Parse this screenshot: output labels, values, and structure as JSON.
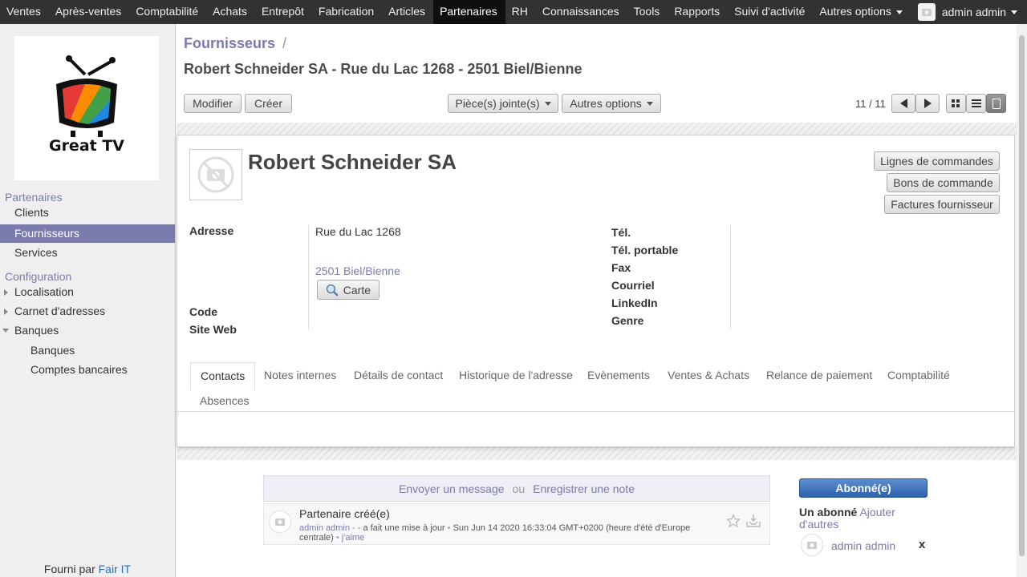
{
  "topbar": {
    "menu": [
      "Ventes",
      "Après-ventes",
      "Comptabilité",
      "Achats",
      "Entrepôt",
      "Fabrication",
      "Articles",
      "Partenaires",
      "RH",
      "Connaissances",
      "Tools",
      "Rapports",
      "Suivi d'activité",
      "Autres options"
    ],
    "active": "Partenaires",
    "user": "admin admin"
  },
  "sidebar": {
    "logo_text": "Great TV",
    "section1": "Partenaires",
    "clients": "Clients",
    "fournisseurs": "Fournisseurs",
    "services": "Services",
    "section2": "Configuration",
    "localisation": "Localisation",
    "carnet": "Carnet d'adresses",
    "banques": "Banques",
    "banques_sub": "Banques",
    "comptes": "Comptes bancaires",
    "powered_prefix": "Fourni par",
    "powered_link": "Fair IT"
  },
  "header": {
    "breadcrumb": "Fournisseurs",
    "breadcrumb_sep": "/",
    "title": "Robert Schneider SA - Rue du Lac 1268 - 2501 Biel/Bienne"
  },
  "toolbar": {
    "edit": "Modifier",
    "create": "Créer",
    "attachments": "Pièce(s) jointe(s)",
    "more": "Autres options",
    "pager": "11 / 11"
  },
  "form": {
    "name": "Robert Schneider SA",
    "buttons": [
      "Lignes de commandes",
      "Bons de commande",
      "Factures fournisseur"
    ],
    "label_address": "Adresse",
    "street": "Rue du Lac 1268",
    "city": "2501 Biel/Bienne",
    "map_button": "Carte",
    "label_code": "Code",
    "label_website": "Site Web",
    "label_phone": "Tél.",
    "label_mobile": "Tél. portable",
    "label_fax": "Fax",
    "label_email": "Courriel",
    "label_linkedin": "LinkedIn",
    "label_gender": "Genre"
  },
  "tabs": [
    "Contacts",
    "Notes internes",
    "Détails de contact",
    "Historique de l'adresse",
    "Evènements",
    "Ventes & Achats",
    "Relance de paiement",
    "Comptabilité",
    "Absences"
  ],
  "chatter": {
    "send_message": "Envoyer un message",
    "or": "ou",
    "log_note": "Enregistrer une note",
    "message_title": "Partenaire créé(e)",
    "author": "admin admin - -",
    "action": "a fait une mise à jour",
    "dot": "•",
    "date": "Sun Jun 14 2020 16:33:04 GMT+0200 (heure d'été d'Europe centrale)",
    "like": "j'aime",
    "followed_button": "Abonné(e)",
    "followers_title": "Un abonné",
    "add_followers": "Ajouter d'autres",
    "follower_name": "admin admin",
    "remove": "x"
  }
}
